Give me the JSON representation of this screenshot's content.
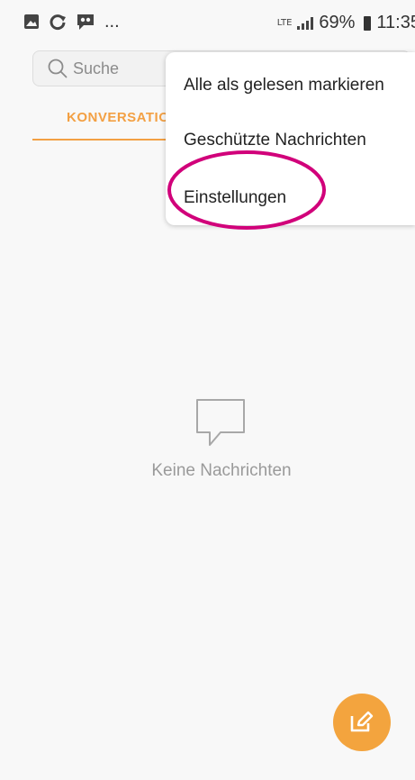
{
  "status_bar": {
    "notification_icons": [
      "image-icon",
      "sync-icon",
      "voicemail-icon"
    ],
    "more_indicator": "...",
    "network_type": "LTE",
    "battery": "69%",
    "time": "11:35"
  },
  "search": {
    "placeholder": "Suche"
  },
  "tabs": [
    {
      "label": "KONVERSATIONEN",
      "active": true
    }
  ],
  "overflow_menu": {
    "items": [
      {
        "label": "Alle als gelesen markieren"
      },
      {
        "label": "Geschützte Nachrichten"
      },
      {
        "label": "Einstellungen",
        "highlighted": true
      }
    ]
  },
  "empty_state": {
    "icon": "chat-bubble-icon",
    "message": "Keine Nachrichten"
  },
  "fab": {
    "icon": "compose-icon"
  },
  "colors": {
    "accent": "#f3a043",
    "highlight_circle": "#d1007a",
    "background": "#f8f8f8"
  }
}
